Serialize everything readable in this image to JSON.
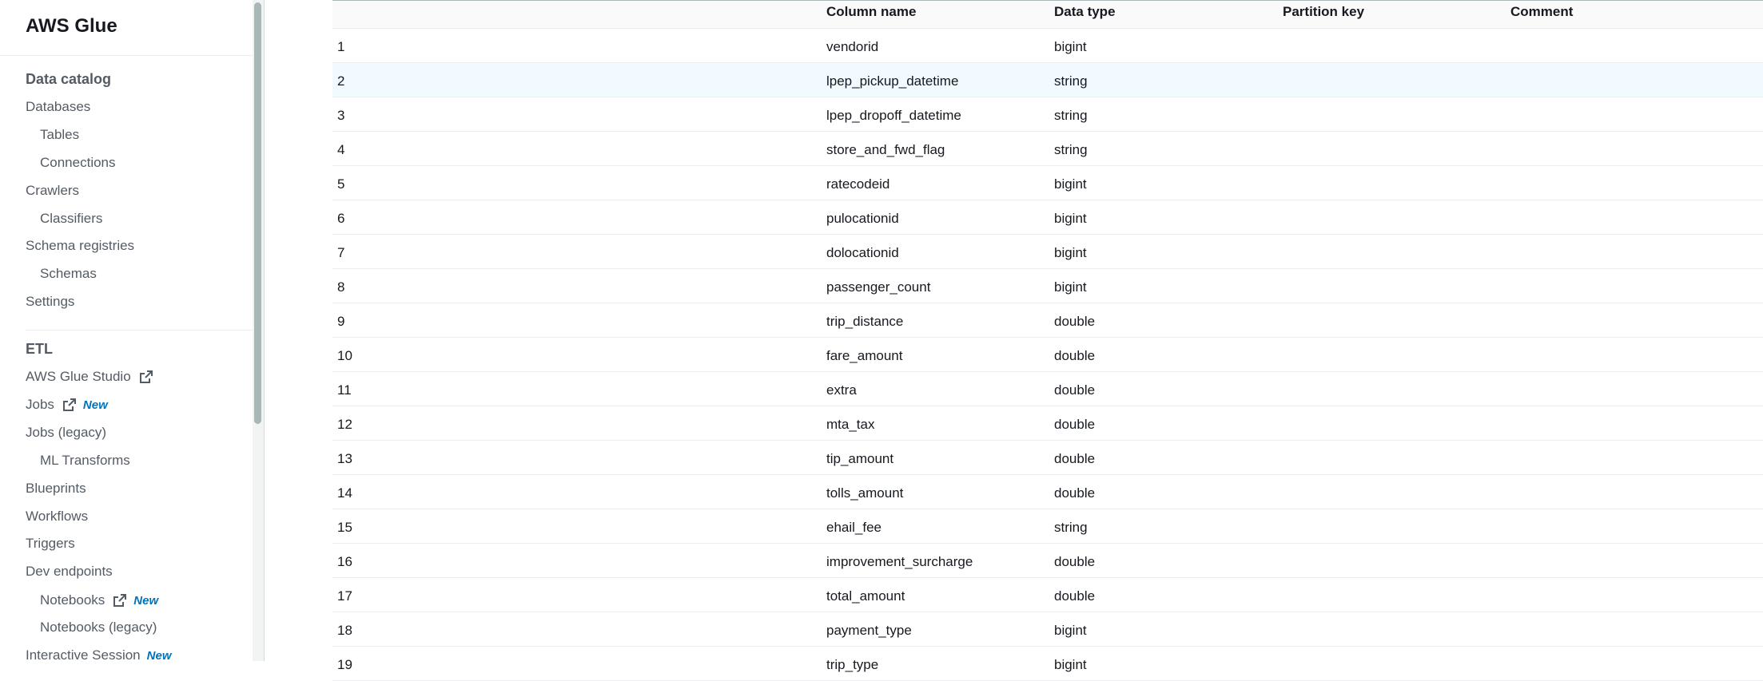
{
  "sidebar": {
    "title": "AWS Glue",
    "sections": [
      {
        "label": "Data catalog",
        "items": [
          {
            "label": "Databases",
            "level": 0
          },
          {
            "label": "Tables",
            "level": 1
          },
          {
            "label": "Connections",
            "level": 1
          },
          {
            "label": "Crawlers",
            "level": 0
          },
          {
            "label": "Classifiers",
            "level": 1
          },
          {
            "label": "Schema registries",
            "level": 0
          },
          {
            "label": "Schemas",
            "level": 1
          },
          {
            "label": "Settings",
            "level": 0
          }
        ]
      },
      {
        "label": "ETL",
        "items": [
          {
            "label": "AWS Glue Studio",
            "level": 0,
            "external": true
          },
          {
            "label": "Jobs",
            "level": 0,
            "external": true,
            "badge": "New"
          },
          {
            "label": "Jobs (legacy)",
            "level": 0
          },
          {
            "label": "ML Transforms",
            "level": 1
          },
          {
            "label": "Blueprints",
            "level": 0
          },
          {
            "label": "Workflows",
            "level": 0
          },
          {
            "label": "Triggers",
            "level": 0
          },
          {
            "label": "Dev endpoints",
            "level": 0
          },
          {
            "label": "Notebooks",
            "level": 1,
            "external": true,
            "badge": "New"
          },
          {
            "label": "Notebooks (legacy)",
            "level": 1
          },
          {
            "label": "Interactive Session",
            "level": 0,
            "badge": "New"
          }
        ]
      }
    ]
  },
  "table": {
    "headers": {
      "index": "",
      "column_name": "Column name",
      "data_type": "Data type",
      "partition_key": "Partition key",
      "comment": "Comment"
    },
    "highlighted_row": 2,
    "rows": [
      {
        "index": "1",
        "name": "vendorid",
        "type": "bigint",
        "partition": "",
        "comment": ""
      },
      {
        "index": "2",
        "name": "lpep_pickup_datetime",
        "type": "string",
        "partition": "",
        "comment": ""
      },
      {
        "index": "3",
        "name": "lpep_dropoff_datetime",
        "type": "string",
        "partition": "",
        "comment": ""
      },
      {
        "index": "4",
        "name": "store_and_fwd_flag",
        "type": "string",
        "partition": "",
        "comment": ""
      },
      {
        "index": "5",
        "name": "ratecodeid",
        "type": "bigint",
        "partition": "",
        "comment": ""
      },
      {
        "index": "6",
        "name": "pulocationid",
        "type": "bigint",
        "partition": "",
        "comment": ""
      },
      {
        "index": "7",
        "name": "dolocationid",
        "type": "bigint",
        "partition": "",
        "comment": ""
      },
      {
        "index": "8",
        "name": "passenger_count",
        "type": "bigint",
        "partition": "",
        "comment": ""
      },
      {
        "index": "9",
        "name": "trip_distance",
        "type": "double",
        "partition": "",
        "comment": ""
      },
      {
        "index": "10",
        "name": "fare_amount",
        "type": "double",
        "partition": "",
        "comment": ""
      },
      {
        "index": "11",
        "name": "extra",
        "type": "double",
        "partition": "",
        "comment": ""
      },
      {
        "index": "12",
        "name": "mta_tax",
        "type": "double",
        "partition": "",
        "comment": ""
      },
      {
        "index": "13",
        "name": "tip_amount",
        "type": "double",
        "partition": "",
        "comment": ""
      },
      {
        "index": "14",
        "name": "tolls_amount",
        "type": "double",
        "partition": "",
        "comment": ""
      },
      {
        "index": "15",
        "name": "ehail_fee",
        "type": "string",
        "partition": "",
        "comment": ""
      },
      {
        "index": "16",
        "name": "improvement_surcharge",
        "type": "double",
        "partition": "",
        "comment": ""
      },
      {
        "index": "17",
        "name": "total_amount",
        "type": "double",
        "partition": "",
        "comment": ""
      },
      {
        "index": "18",
        "name": "payment_type",
        "type": "bigint",
        "partition": "",
        "comment": ""
      },
      {
        "index": "19",
        "name": "trip_type",
        "type": "bigint",
        "partition": "",
        "comment": ""
      }
    ]
  },
  "colors": {
    "link_blue": "#0073bb",
    "row_highlight": "#f1faff",
    "nav_text": "#545b64"
  },
  "icons": {
    "external": "external-link-icon"
  }
}
